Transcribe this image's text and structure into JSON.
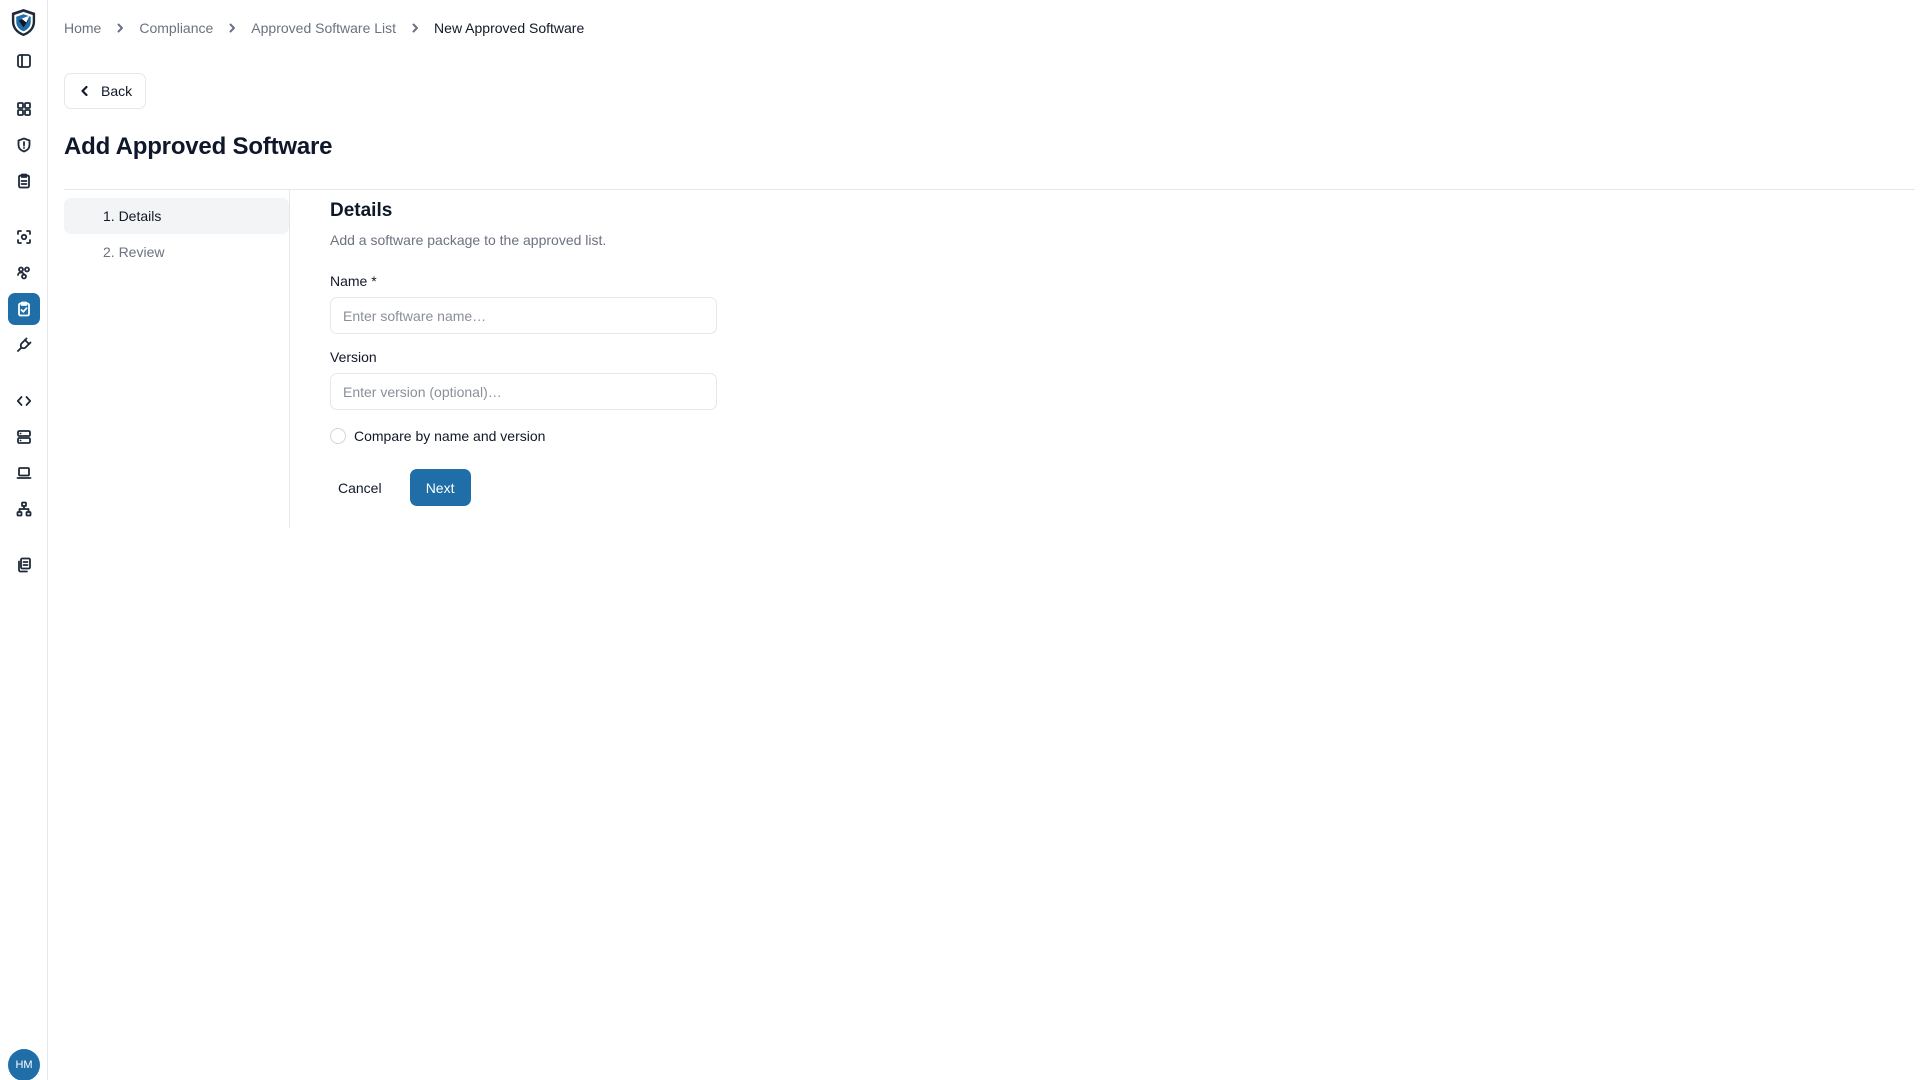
{
  "sidebar": {
    "logo_icon": "shield-logo-icon",
    "items": [
      {
        "icon": "panel-toggle-icon",
        "active": false
      },
      {
        "icon": "dashboard-grid-icon",
        "active": false
      },
      {
        "icon": "shield-icon",
        "active": false
      },
      {
        "icon": "clipboard-icon",
        "active": false
      },
      {
        "icon": "scan-icon",
        "active": false
      },
      {
        "icon": "users-icon",
        "active": false
      },
      {
        "icon": "clipboard-check-icon",
        "active": true
      },
      {
        "icon": "plug-icon",
        "active": false
      },
      {
        "icon": "code-icon",
        "active": false
      },
      {
        "icon": "server-icon",
        "active": false
      },
      {
        "icon": "laptop-icon",
        "active": false
      },
      {
        "icon": "network-icon",
        "active": false
      },
      {
        "icon": "documents-icon",
        "active": false
      }
    ],
    "avatar_initials": "HM",
    "accent_color": "#1f6ea8"
  },
  "breadcrumb": {
    "items": [
      "Home",
      "Compliance",
      "Approved Software List",
      "New Approved Software"
    ]
  },
  "back_label": "Back",
  "page_title": "Add Approved Software",
  "steps": [
    "1. Details",
    "2. Review"
  ],
  "active_step": 0,
  "form": {
    "title": "Details",
    "subtitle": "Add a software package to the approved list.",
    "name_label": "Name *",
    "name_placeholder": "Enter software name…",
    "name_value": "",
    "version_label": "Version",
    "version_placeholder": "Enter version (optional)…",
    "version_value": "",
    "compare_label": "Compare by name and version",
    "compare_checked": false,
    "cancel_label": "Cancel",
    "next_label": "Next"
  }
}
